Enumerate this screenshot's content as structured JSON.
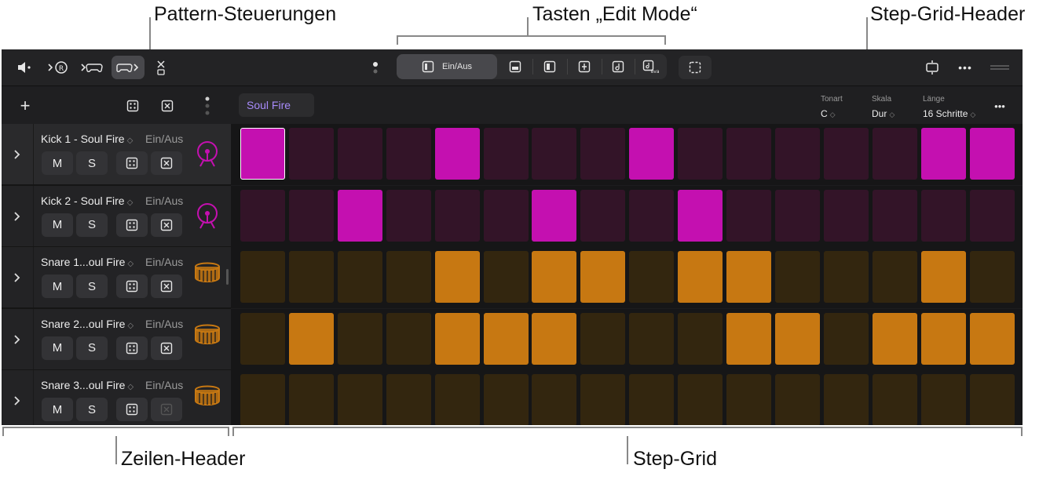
{
  "callouts": {
    "pattern_controls": "Pattern-Steuerungen",
    "edit_mode_buttons": "Tasten „Edit Mode“",
    "step_grid_header": "Step-Grid-Header",
    "row_header": "Zeilen-Header",
    "step_grid": "Step-Grid"
  },
  "toolbar": {
    "left_icons": [
      "speaker-icon",
      "record-arm-icon",
      "gamepad-arrow-icon",
      "gamepad-active-icon",
      "close-stack-icon"
    ],
    "edit_modes": [
      {
        "icon": "split-panel-icon",
        "label": "Ein/Aus",
        "active": true
      },
      {
        "icon": "velocity-icon",
        "label": ""
      },
      {
        "icon": "half-panel-icon",
        "label": ""
      },
      {
        "icon": "step-offset-icon",
        "label": ""
      },
      {
        "icon": "note-icon",
        "label": ""
      },
      {
        "icon": "octave-icon",
        "label": "8va"
      }
    ],
    "select_icon": "selection-icon",
    "right_icons": [
      "loop-icon",
      "more-icon",
      "handle-icon"
    ]
  },
  "subbar": {
    "pattern_name": "Soul Fire",
    "key_label": "Tonart",
    "key_value": "C",
    "scale_label": "Skala",
    "scale_value": "Dur",
    "length_label": "Länge",
    "length_value": "16 Schritte",
    "more": "•••"
  },
  "colors": {
    "magenta_on": "#c410b0",
    "magenta_off": "#331428",
    "orange_on": "#c77812",
    "orange_off": "#33260f"
  },
  "rows": [
    {
      "name": "Kick 1 - Soul Fire",
      "mode": "Ein/Aus",
      "mute": "M",
      "solo": "S",
      "instrument": "kick-drum-icon",
      "color": "magenta",
      "steps": [
        1,
        0,
        0,
        0,
        1,
        0,
        0,
        0,
        1,
        0,
        0,
        0,
        0,
        0,
        1,
        1
      ]
    },
    {
      "name": "Kick 2 - Soul Fire",
      "mode": "Ein/Aus",
      "mute": "M",
      "solo": "S",
      "instrument": "kick-drum-icon",
      "color": "magenta",
      "steps": [
        0,
        0,
        1,
        0,
        0,
        0,
        1,
        0,
        0,
        1,
        0,
        0,
        0,
        0,
        0,
        0
      ]
    },
    {
      "name": "Snare 1...oul Fire",
      "mode": "Ein/Aus",
      "mute": "M",
      "solo": "S",
      "instrument": "snare-drum-icon",
      "color": "orange",
      "steps": [
        0,
        0,
        0,
        0,
        1,
        0,
        1,
        1,
        0,
        1,
        1,
        0,
        0,
        0,
        1,
        0
      ]
    },
    {
      "name": "Snare 2...oul Fire",
      "mode": "Ein/Aus",
      "mute": "M",
      "solo": "S",
      "instrument": "snare-drum-icon",
      "color": "orange",
      "steps": [
        0,
        1,
        0,
        0,
        1,
        1,
        1,
        0,
        0,
        0,
        1,
        1,
        0,
        1,
        1,
        1
      ]
    },
    {
      "name": "Snare 3...oul Fire",
      "mode": "Ein/Aus",
      "mute": "M",
      "solo": "S",
      "instrument": "snare-drum-icon",
      "color": "orange",
      "steps": [
        0,
        0,
        0,
        0,
        0,
        0,
        0,
        0,
        0,
        0,
        0,
        0,
        0,
        0,
        0,
        0
      ]
    }
  ]
}
